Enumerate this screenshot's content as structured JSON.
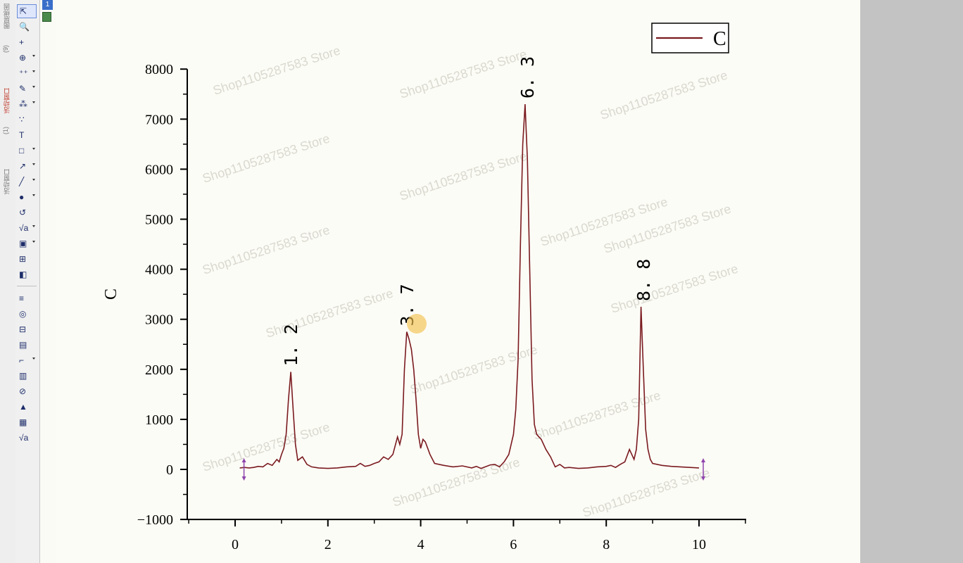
{
  "colors": {
    "series": "#7a1a1f",
    "axis": "#000000",
    "canvas": "#fcfcf6",
    "right_panel": "#c3c3c3"
  },
  "sidebar": {
    "texts": [
      {
        "label": "图层绑固",
        "color": "gray"
      },
      {
        "label": "(9)",
        "color": "gray"
      },
      {
        "label": "活动窗口",
        "color": "red"
      },
      {
        "label": "(1)",
        "color": "gray"
      },
      {
        "label": "活动窗口",
        "color": "gray"
      }
    ]
  },
  "toolbar": {
    "tools": [
      {
        "name": "pointer-icon",
        "glyph": "⇱",
        "active": true,
        "menu": false
      },
      {
        "name": "zoom-icon",
        "glyph": "🔍",
        "active": false,
        "menu": false
      },
      {
        "name": "reader-icon",
        "glyph": "+",
        "active": false,
        "menu": false
      },
      {
        "name": "screen-reader-icon",
        "glyph": "⊕",
        "active": false,
        "menu": true
      },
      {
        "name": "data-reader-icon",
        "glyph": "⁺⁺",
        "active": false,
        "menu": true
      },
      {
        "name": "mask-icon",
        "glyph": "✎",
        "active": false,
        "menu": true
      },
      {
        "name": "brush-icon",
        "glyph": "⁂",
        "active": false,
        "menu": true
      },
      {
        "name": "draw-data-icon",
        "glyph": "∵",
        "active": false,
        "menu": false
      },
      {
        "name": "text-tool-icon",
        "glyph": "T",
        "active": false,
        "menu": false
      },
      {
        "name": "rectangle-tool-icon",
        "glyph": "□",
        "active": false,
        "menu": true
      },
      {
        "name": "arrow-tool-icon",
        "glyph": "↗",
        "active": false,
        "menu": true
      },
      {
        "name": "line-tool-icon",
        "glyph": "╱",
        "active": false,
        "menu": true
      },
      {
        "name": "ellipse-tool-icon",
        "glyph": "●",
        "active": false,
        "menu": true
      },
      {
        "name": "region-tool-icon",
        "glyph": "↺",
        "active": false,
        "menu": false
      },
      {
        "name": "equation-icon",
        "glyph": "√a",
        "active": false,
        "menu": true
      },
      {
        "name": "insert-graph-icon",
        "glyph": "▣",
        "active": false,
        "menu": true
      },
      {
        "name": "insert-table-icon",
        "glyph": "⊞",
        "active": false,
        "menu": false
      },
      {
        "name": "layer-icon",
        "glyph": "◧",
        "active": false,
        "menu": false
      },
      {
        "name": "color-bars-icon",
        "glyph": "≡",
        "active": false,
        "menu": false
      },
      {
        "name": "circle-icon",
        "glyph": "◎",
        "active": false,
        "menu": false
      },
      {
        "name": "merge-icon",
        "glyph": "⊟",
        "active": false,
        "menu": false
      },
      {
        "name": "layout-icon",
        "glyph": "▤",
        "active": false,
        "menu": false
      },
      {
        "name": "crop-icon",
        "glyph": "⌐",
        "active": false,
        "menu": true
      },
      {
        "name": "note-icon",
        "glyph": "▥",
        "active": false,
        "menu": false
      },
      {
        "name": "image-icon",
        "glyph": "⊘",
        "active": false,
        "menu": false
      },
      {
        "name": "export-icon",
        "glyph": "▲",
        "active": false,
        "menu": false
      },
      {
        "name": "grid-icon",
        "glyph": "▦",
        "active": false,
        "menu": false
      },
      {
        "name": "equation2-icon",
        "glyph": "√a",
        "active": false,
        "menu": false
      }
    ]
  },
  "page_tab": {
    "number": "1"
  },
  "watermark": "Shop1105287583 Store",
  "chart_data": {
    "type": "line",
    "title": "",
    "xlabel": "",
    "ylabel": "C",
    "xlim": [
      0,
      10
    ],
    "ylim": [
      -1000,
      8000
    ],
    "xticks": [
      0,
      2,
      4,
      6,
      8,
      10
    ],
    "yticks": [
      -1000,
      0,
      1000,
      2000,
      3000,
      4000,
      5000,
      6000,
      7000,
      8000
    ],
    "grid": false,
    "legend": "top-right",
    "series": [
      {
        "name": "C",
        "color": "#7a1a1f",
        "x": [
          0.1,
          0.2,
          0.3,
          0.4,
          0.5,
          0.6,
          0.7,
          0.8,
          0.9,
          0.95,
          1.0,
          1.05,
          1.1,
          1.15,
          1.2,
          1.25,
          1.3,
          1.35,
          1.45,
          1.55,
          1.65,
          1.8,
          2.0,
          2.2,
          2.4,
          2.6,
          2.7,
          2.8,
          2.9,
          3.0,
          3.1,
          3.2,
          3.3,
          3.4,
          3.5,
          3.55,
          3.6,
          3.65,
          3.7,
          3.75,
          3.8,
          3.85,
          3.9,
          3.95,
          4.0,
          4.05,
          4.1,
          4.2,
          4.3,
          4.5,
          4.7,
          4.9,
          5.1,
          5.2,
          5.3,
          5.5,
          5.6,
          5.7,
          5.8,
          5.9,
          6.0,
          6.05,
          6.1,
          6.15,
          6.2,
          6.25,
          6.3,
          6.35,
          6.4,
          6.45,
          6.5,
          6.55,
          6.6,
          6.7,
          6.8,
          6.9,
          7.0,
          7.1,
          7.2,
          7.4,
          7.6,
          7.8,
          8.0,
          8.1,
          8.2,
          8.3,
          8.4,
          8.5,
          8.6,
          8.65,
          8.7,
          8.75,
          8.8,
          8.85,
          8.9,
          8.95,
          9.0,
          9.2,
          9.4,
          9.6,
          9.8,
          10.0
        ],
        "values": [
          30,
          40,
          30,
          40,
          60,
          50,
          120,
          80,
          200,
          150,
          300,
          420,
          700,
          1400,
          1950,
          1200,
          500,
          180,
          250,
          100,
          50,
          30,
          20,
          30,
          50,
          60,
          120,
          60,
          80,
          120,
          150,
          250,
          200,
          300,
          650,
          500,
          700,
          2000,
          2750,
          2600,
          2400,
          2000,
          1400,
          700,
          420,
          600,
          550,
          300,
          120,
          80,
          50,
          70,
          30,
          60,
          20,
          90,
          100,
          50,
          150,
          300,
          700,
          1200,
          2200,
          4500,
          6500,
          7300,
          6200,
          4000,
          1800,
          900,
          700,
          650,
          600,
          400,
          250,
          50,
          100,
          30,
          40,
          20,
          30,
          50,
          60,
          80,
          40,
          100,
          150,
          400,
          200,
          400,
          1000,
          3250,
          2000,
          800,
          400,
          200,
          120,
          80,
          60,
          50,
          40,
          30
        ]
      }
    ],
    "annotations": [
      {
        "text": "1. 2",
        "x": 1.2
      },
      {
        "text": "3. 7",
        "x": 3.7
      },
      {
        "text": "6. 3",
        "x": 6.3
      },
      {
        "text": "8. 8",
        "x": 8.8
      }
    ]
  }
}
